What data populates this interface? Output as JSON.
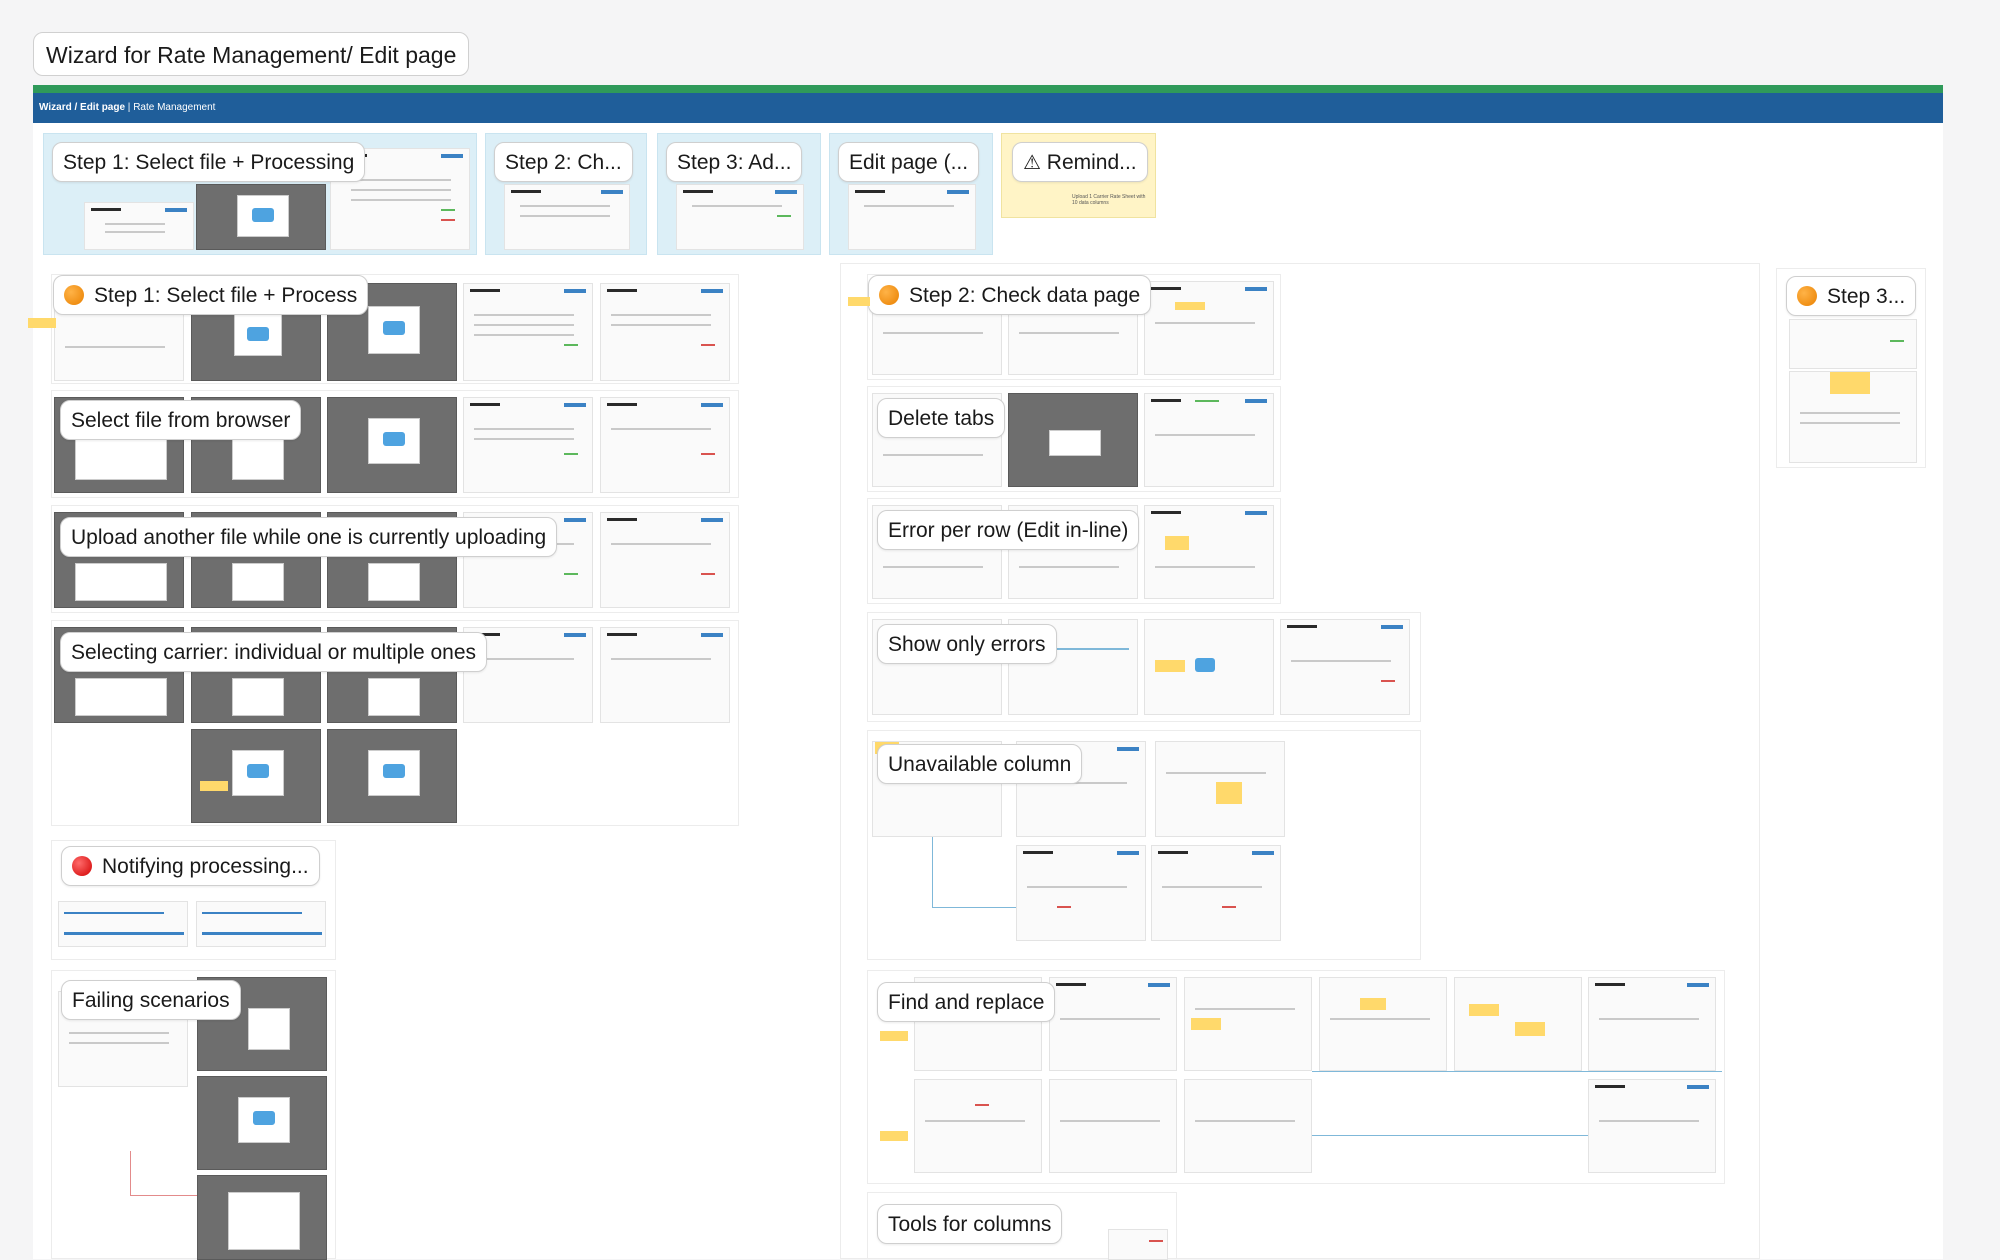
{
  "board": {
    "title": "Wizard for Rate Management/ Edit page",
    "breadcrumb_bold": "Wizard / Edit page",
    "breadcrumb_sep": " | ",
    "breadcrumb_rest": "Rate Management"
  },
  "step_tabs": [
    {
      "label": "Step 1: Select file + Processing"
    },
    {
      "label": "Step 2: Ch..."
    },
    {
      "label": "Step 3: Ad..."
    },
    {
      "label": "Edit page (..."
    },
    {
      "label": "Remind...",
      "icon": "warning-icon"
    }
  ],
  "reminder_text": "Upload 1 Carrier Rate Sheet with 10 data columns",
  "sections_left": [
    {
      "label": "Step 1: Select file + Process",
      "icon": "orange-dot-icon"
    },
    {
      "label": "Select file from browser"
    },
    {
      "label": "Upload another file while one is currently uploading"
    },
    {
      "label": "Selecting carrier: individual or multiple ones"
    },
    {
      "label": "Notifying processing...",
      "icon": "red-dot-icon"
    },
    {
      "label": "Failing scenarios"
    }
  ],
  "sections_right": [
    {
      "label": "Step 2: Check data page",
      "icon": "orange-dot-icon"
    },
    {
      "label": "Delete tabs"
    },
    {
      "label": "Error per row (Edit in-line)"
    },
    {
      "label": "Show only errors"
    },
    {
      "label": "Unavailable column"
    },
    {
      "label": "Find and replace"
    },
    {
      "label": "Tools for columns"
    }
  ],
  "sections_far_right": [
    {
      "label": "Step 3...",
      "icon": "orange-dot-icon"
    }
  ],
  "colors": {
    "green_bar": "#2f9a5a",
    "blue_bar": "#1f5e9a",
    "step_bg": "#dceff7",
    "warn_bg": "#fff4c6"
  }
}
